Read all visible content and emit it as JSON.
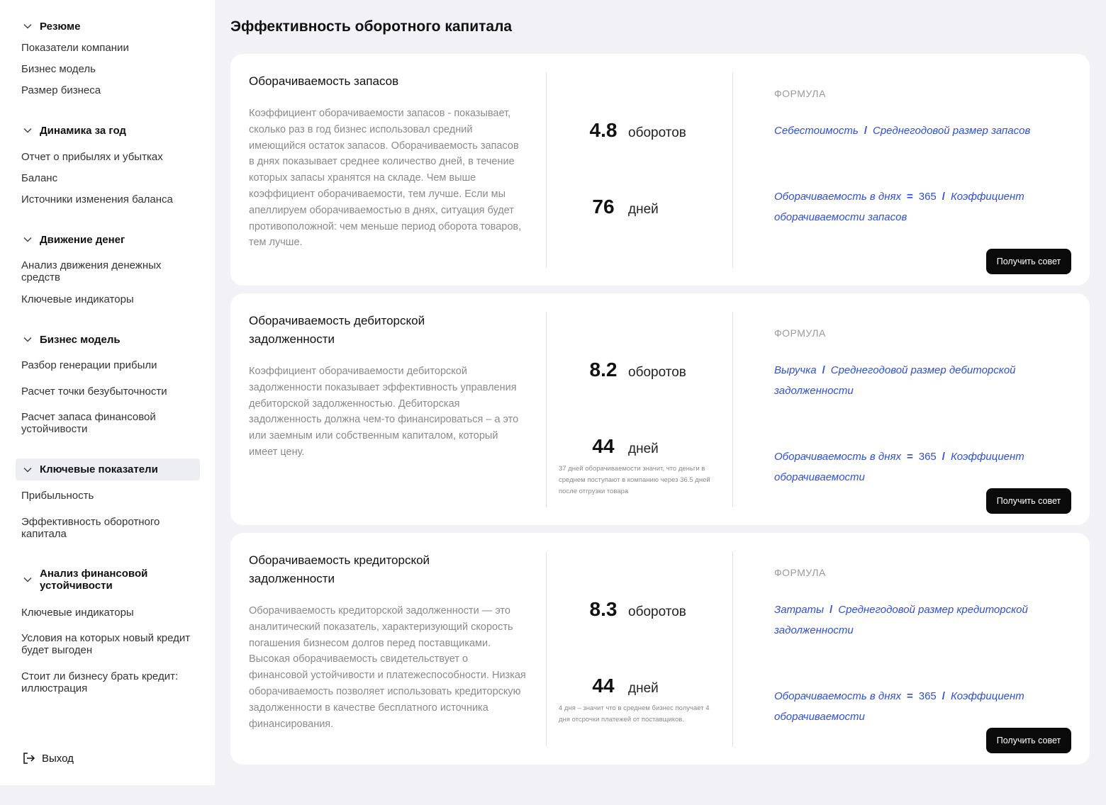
{
  "sidebar": {
    "sections": [
      {
        "title": "Резюме",
        "items": [
          "Показатели компании",
          "Бизнес модель",
          "Размер бизнеса"
        ]
      },
      {
        "title": "Динамика за год",
        "items": [
          "Отчет о прибылях и убытках",
          "Баланс",
          "Источники изменения баланса"
        ]
      },
      {
        "title": "Движение денег",
        "items": [
          "Анализ движения денежных средств",
          "Ключевые индикаторы"
        ]
      },
      {
        "title": "Бизнес модель",
        "items": [
          "Разбор генерации прибыли",
          "Расчет точки безубыточности",
          "Расчет  запаса финансовой устойчивости"
        ]
      },
      {
        "title": "Ключевые показатели",
        "items": [
          "Прибыльность",
          "Эффективность оборотного капитала"
        ]
      },
      {
        "title": "Анализ финансовой устойчивости",
        "items": [
          "Ключевые индикаторы",
          "Условия на которых новый кредит будет выгоден",
          "Стоит ли бизнесу брать кредит: иллюстрация"
        ]
      }
    ],
    "logout": "Выход"
  },
  "page": {
    "title": "Эффективность оборотного капитала"
  },
  "cards": [
    {
      "title": "Оборачиваемость запасов",
      "description": "Коэффициент оборачиваемости запасов - показывает, сколько раз в год бизнес использовал средний имеющийся остаток запасов. Оборачиваемость запасов в днях показывает среднее количество дней, в течение которых запасы хранятся на складе. Чем выше коэффициент оборачиваемости, тем лучше. Если мы апеллируем оборачиваемостью в днях, ситуация будет противоположной: чем меньше период оборота товаров, тем лучше.",
      "turnover_value": "4.8",
      "turnover_unit": "оборотов",
      "days_value": "76",
      "days_unit": "дней",
      "note": "",
      "formula_label": "ФОРМУЛА",
      "formula1_a": "Себестоимость",
      "formula1_op": "/",
      "formula1_b": "Среднегодовой размер запасов",
      "formula2_a": "Оборачиваемость в днях",
      "formula2_eq": "=",
      "formula2_num": "365",
      "formula2_op": "/",
      "formula2_b": "Коэффициент оборачиваемости запасов",
      "button": "Получить совет"
    },
    {
      "title": "Оборачиваемость дебиторской задолженности",
      "description": "Коэффициент оборачиваемости дебиторской задолженности показывает эффективность управления дебиторской задолженностью. Дебиторская задолженность должна чем-то финансироваться – а это или  заемным или собственным капиталом, который имеет цену.",
      "turnover_value": "8.2",
      "turnover_unit": "оборотов",
      "days_value": "44",
      "days_unit": "дней",
      "note": "37 дней оборачиваемости значит, что деньги в среднем поступают в компанию через 36.5 дней после отгрузки товара",
      "formula_label": "ФОРМУЛА",
      "formula1_a": "Выручка",
      "formula1_op": "/",
      "formula1_b": "Среднегодовой размер  дебиторской задолженности",
      "formula2_a": "Оборачиваемость в днях",
      "formula2_eq": "=",
      "formula2_num": "365",
      "formula2_op": "/",
      "formula2_b": "Коэффициент оборачиваемости",
      "button": "Получить совет"
    },
    {
      "title": "Оборачиваемость кредиторской задолженности",
      "description": "Оборачиваемость кредиторской задолженности — это аналитический показатель, характеризующий скорость погашения бизнесом долгов перед поставщиками. Высокая оборачиваемость свидетельствует о финансовой устойчивости и платежеспособности. Низкая оборачиваемость позволяет использовать кредиторскую задолженности в качестве бесплатного источника финансирования.",
      "turnover_value": "8.3",
      "turnover_unit": "оборотов",
      "days_value": "44",
      "days_unit": "дней",
      "note": "4 дня – значит что в среднем бизнес получает 4 дня отсрочки платежей от поставщиков.",
      "formula_label": "ФОРМУЛА",
      "formula1_a": "Затраты",
      "formula1_op": "/",
      "formula1_b": "Среднегодовой размер  кредиторской задолженности",
      "formula2_a": "Оборачиваемость в днях",
      "formula2_eq": "=",
      "formula2_num": "365",
      "formula2_op": "/",
      "formula2_b": "Коэффициент оборачиваемости",
      "button": "Получить совет"
    }
  ]
}
